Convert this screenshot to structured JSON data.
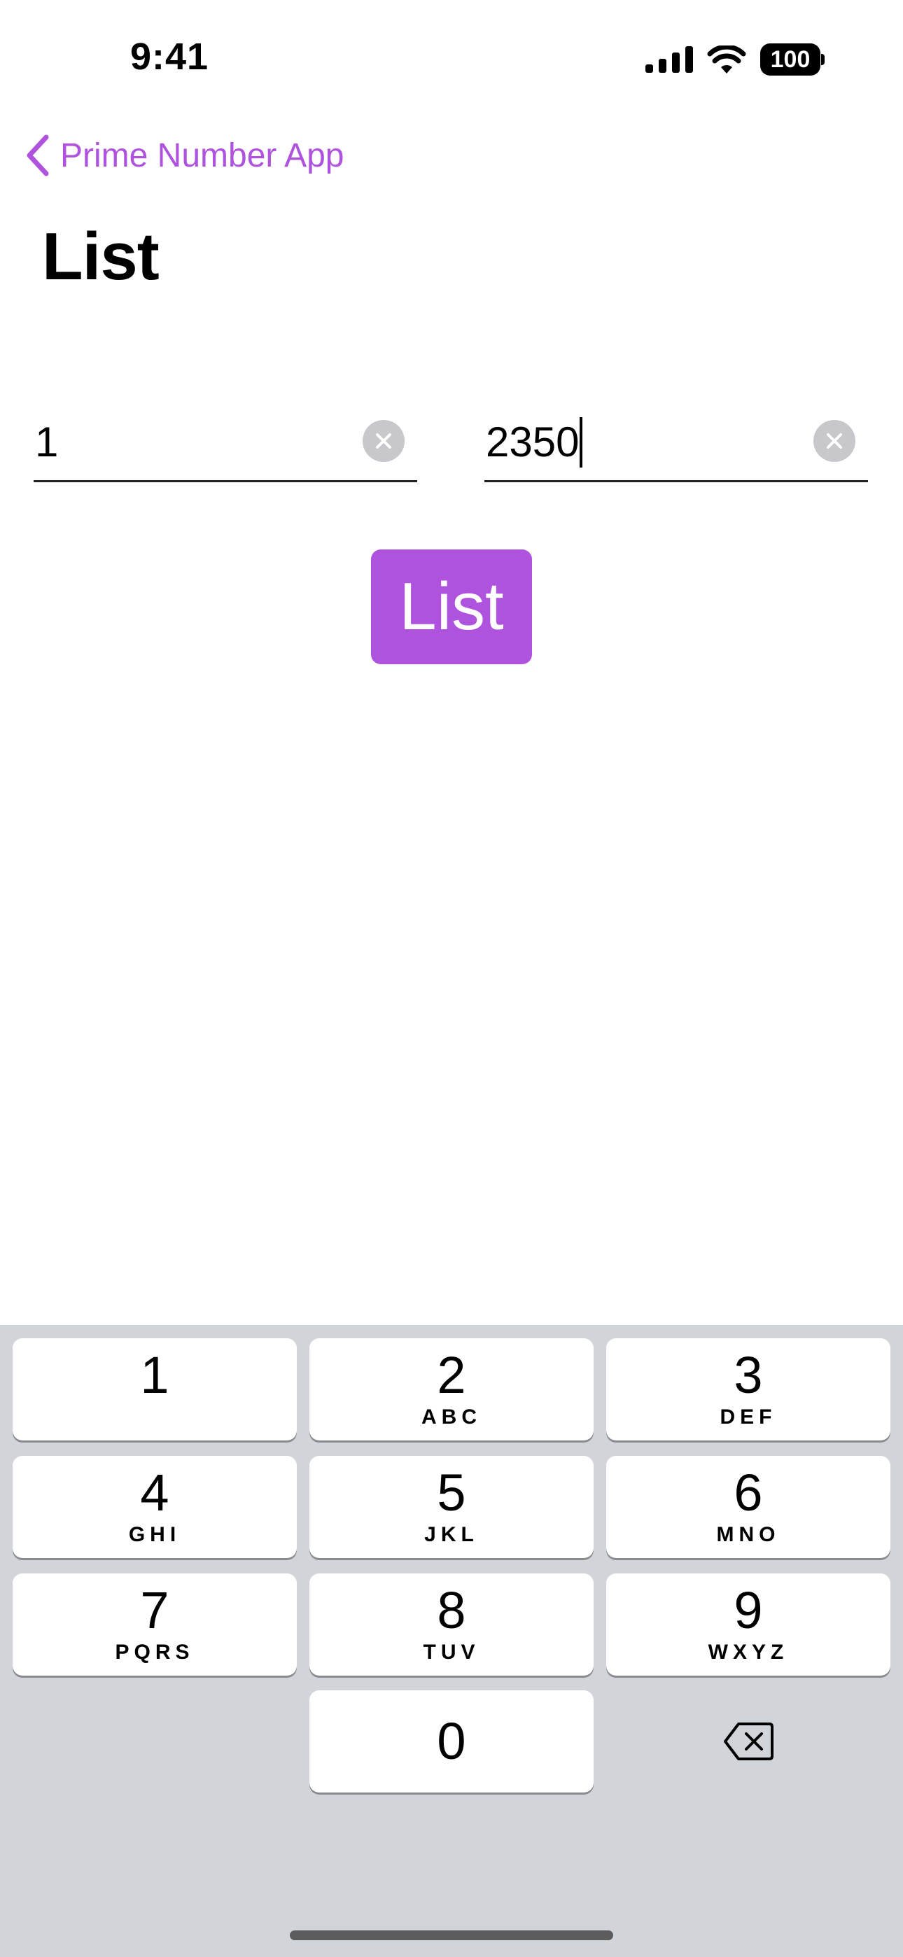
{
  "status_bar": {
    "time": "9:41",
    "battery_level": "100",
    "icons": [
      "cellular-signal-icon",
      "wifi-icon",
      "battery-icon"
    ]
  },
  "nav": {
    "back_label": "Prime Number App",
    "title": "List"
  },
  "fields": {
    "start_value": "1",
    "end_value": "2350"
  },
  "actions": {
    "list_button_label": "List"
  },
  "keyboard": {
    "keys": [
      {
        "digit": "1",
        "letters": ""
      },
      {
        "digit": "2",
        "letters": "ABC"
      },
      {
        "digit": "3",
        "letters": "DEF"
      },
      {
        "digit": "4",
        "letters": "GHI"
      },
      {
        "digit": "5",
        "letters": "JKL"
      },
      {
        "digit": "6",
        "letters": "MNO"
      },
      {
        "digit": "7",
        "letters": "PQRS"
      },
      {
        "digit": "8",
        "letters": "TUV"
      },
      {
        "digit": "9",
        "letters": "WXYZ"
      },
      {
        "digit": "0",
        "letters": ""
      }
    ]
  },
  "colors": {
    "accent": "#af52de",
    "keyboard_background": "#d1d4d9",
    "key_background": "#ffffff",
    "clear_button": "#c7c7cc"
  }
}
